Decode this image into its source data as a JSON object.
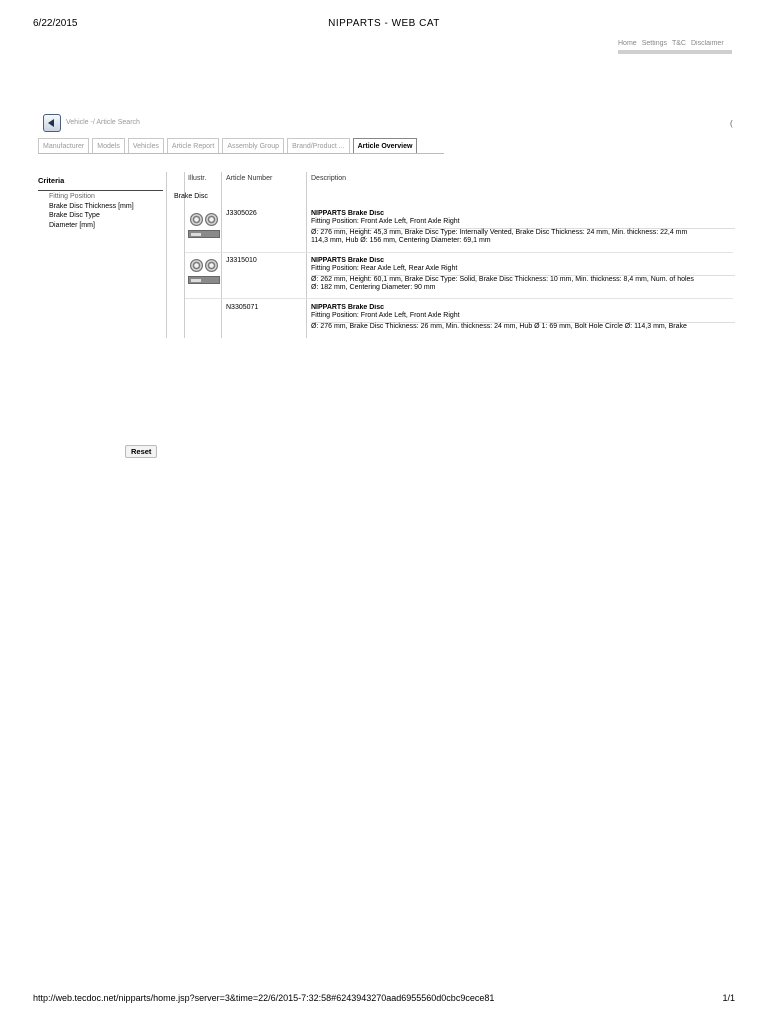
{
  "print_header": {
    "date": "6/22/2015",
    "title": "NIPPARTS - WEB CAT"
  },
  "print_footer": {
    "url": "http://web.tecdoc.net/nipparts/home.jsp?server=3&time=22/6/2015-7:32:58#6243943270aad6955560d0cbc9cece81",
    "page": "1/1"
  },
  "top_nav": {
    "items": [
      "Home",
      "Settings",
      "T&C",
      "Disclaimer"
    ]
  },
  "toolbar": {
    "back_label": "Vehicle -/ Article Search",
    "right_mark": "("
  },
  "tabs": [
    {
      "label": "Manufacturer",
      "active": false
    },
    {
      "label": "Models",
      "active": false
    },
    {
      "label": "Vehicles",
      "active": false
    },
    {
      "label": "Article Report",
      "active": false
    },
    {
      "label": "Assembly Group",
      "active": false
    },
    {
      "label": "Brand/Product ...",
      "active": false
    },
    {
      "label": "Article Overview",
      "active": true
    }
  ],
  "criteria": {
    "title": "Criteria",
    "items": [
      "Fitting Position",
      "Brake Disc Thickness [mm]",
      "Brake Disc Type",
      "Diameter [mm]"
    ]
  },
  "table": {
    "columns": {
      "illustr": "Illustr.",
      "article_number": "Article Number",
      "description": "Description"
    },
    "group_label": "Brake Disc",
    "rows": [
      {
        "article_number": "J3305026",
        "has_image": true,
        "name": "NIPPARTS Brake Disc",
        "fitting": "Fitting Position: Front Axle Left, Front Axle Right",
        "specs": "Ø: 276 mm, Height: 45,3 mm, Brake Disc Type: Internally Vented, Brake Disc Thickness: 24 mm, Min. thickness: 22,4 mm",
        "specs2": "114,3 mm, Hub Ø: 156 mm, Centering Diameter: 69,1 mm"
      },
      {
        "article_number": "J3315010",
        "has_image": true,
        "name": "NIPPARTS Brake Disc",
        "fitting": "Fitting Position: Rear Axle Left, Rear Axle Right",
        "specs": "Ø: 262 mm, Height: 60,1 mm, Brake Disc Type: Solid, Brake Disc Thickness: 10 mm, Min. thickness: 8,4 mm, Num. of holes",
        "specs2": "Ø: 182 mm, Centering Diameter: 90 mm"
      },
      {
        "article_number": "N3305071",
        "has_image": false,
        "name": "NIPPARTS Brake Disc",
        "fitting": "Fitting Position: Front Axle Left, Front Axle Right",
        "specs": "Ø: 276 mm, Brake Disc Thickness: 26 mm, Min. thickness: 24 mm, Hub Ø 1: 69 mm, Bolt Hole Circle Ø: 114,3 mm, Brake",
        "specs2": ""
      }
    ]
  },
  "reset_label": "Reset"
}
